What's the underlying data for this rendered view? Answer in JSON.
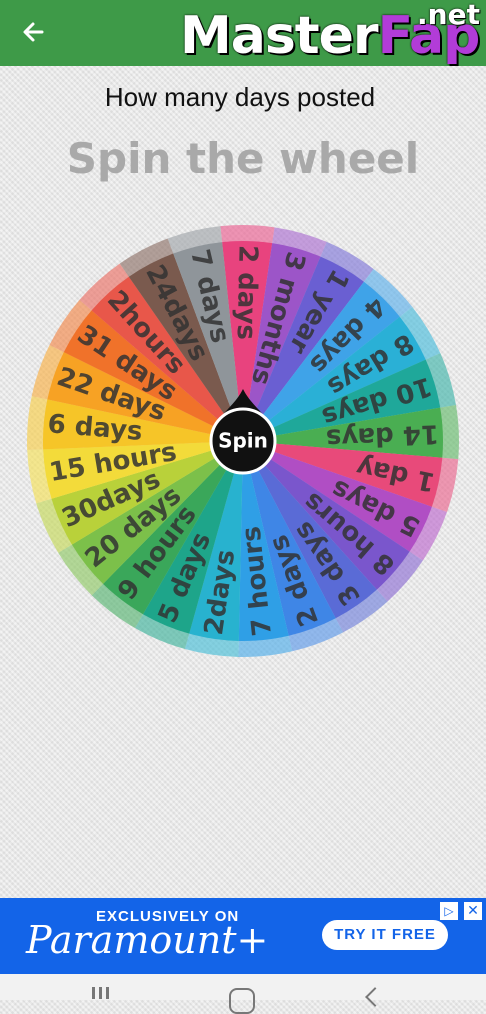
{
  "header": {
    "back_icon": "arrow-left-icon",
    "brand_main_a": "Master",
    "brand_main_b": "Fap",
    "brand_tld": ".net",
    "bar_color": "#3e9a48"
  },
  "question": "How many days posted",
  "title": "Spin the wheel",
  "wheel": {
    "center_label": "Spin",
    "segments": [
      {
        "label": "2 days",
        "color": "#e8437e"
      },
      {
        "label": "3 months",
        "color": "#9c55c8"
      },
      {
        "label": "1 year",
        "color": "#6a5fd2"
      },
      {
        "label": "4 days",
        "color": "#3fa3e8"
      },
      {
        "label": "8 days",
        "color": "#2ab0d6"
      },
      {
        "label": "10 days",
        "color": "#1fa89a"
      },
      {
        "label": "14 days",
        "color": "#4aae52"
      },
      {
        "label": "1 day",
        "color": "#e84a7a"
      },
      {
        "label": "5 days",
        "color": "#b04ec4"
      },
      {
        "label": "8 hours",
        "color": "#7a56cc"
      },
      {
        "label": "3 days",
        "color": "#5a6bd6"
      },
      {
        "label": "2 days",
        "color": "#3f86e6"
      },
      {
        "label": "7 hours",
        "color": "#2f9fe6"
      },
      {
        "label": "2days",
        "color": "#28b2cf"
      },
      {
        "label": "5 days",
        "color": "#1ea58a"
      },
      {
        "label": "9 hours",
        "color": "#3aa75a"
      },
      {
        "label": "20 days",
        "color": "#7cc04a"
      },
      {
        "label": "30days",
        "color": "#b9d13a"
      },
      {
        "label": "15 hours",
        "color": "#f3db3a"
      },
      {
        "label": "6 days",
        "color": "#f6c528"
      },
      {
        "label": "22 days",
        "color": "#f7a224"
      },
      {
        "label": "31 days",
        "color": "#f0722a"
      },
      {
        "label": "2hours",
        "color": "#e8574a"
      },
      {
        "label": "24days",
        "color": "#7a5a4e"
      },
      {
        "label": "7 days",
        "color": "#8f959a"
      }
    ]
  },
  "ad": {
    "small_text": "EXCLUSIVELY ON",
    "brand": "Paramount+",
    "cta": "TRY IT FREE",
    "choices_icon": "ad-choices-icon",
    "close_icon": "close-icon"
  },
  "navbar": {
    "recents_icon": "recents-icon",
    "home_icon": "home-icon",
    "back_icon": "back-icon"
  }
}
